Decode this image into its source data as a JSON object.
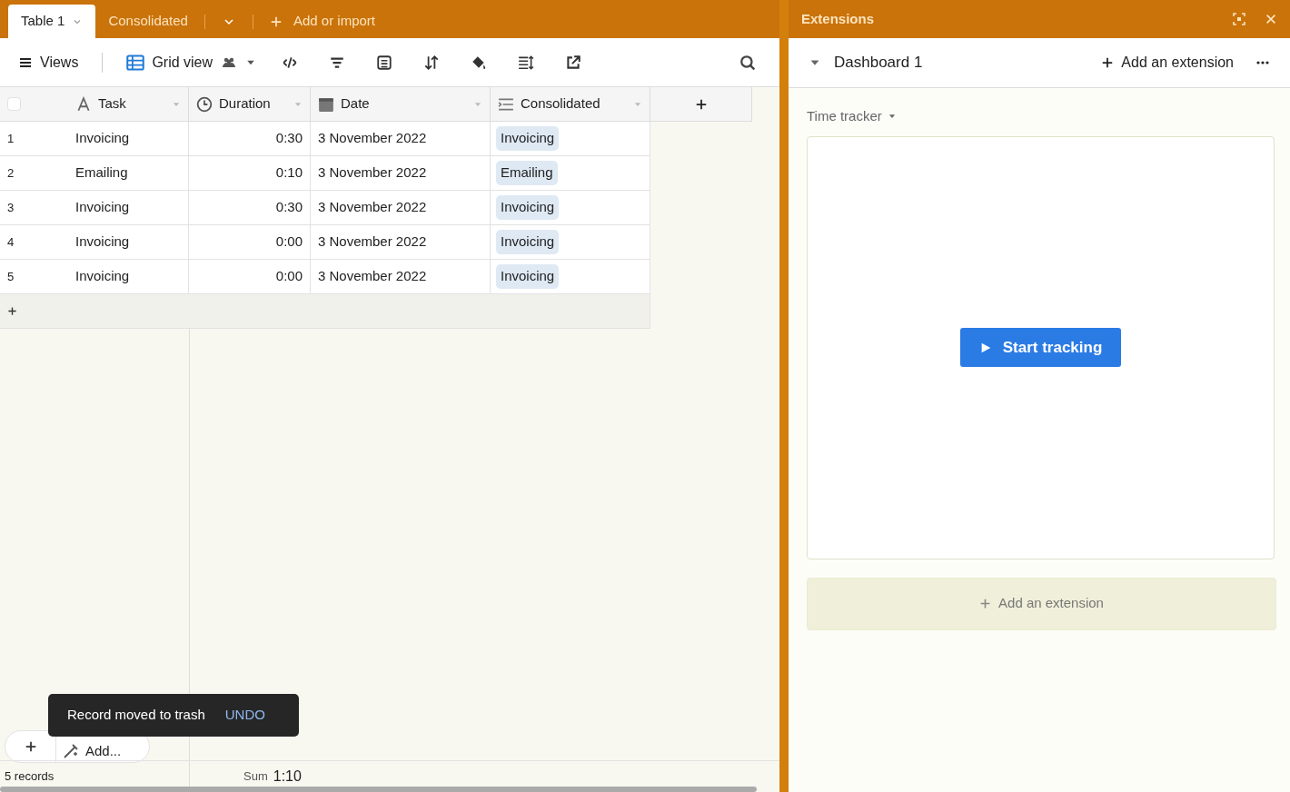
{
  "tabs": [
    {
      "label": "Table 1",
      "selected": true
    },
    {
      "label": "Consolidated",
      "selected": false
    }
  ],
  "add_import": "Add or import",
  "select_all": {
    "checked": false
  },
  "toolbar": {
    "views": "Views",
    "view_name": "Grid view"
  },
  "columns": [
    {
      "label": "Task",
      "kind": "text"
    },
    {
      "label": "Duration",
      "kind": "duration"
    },
    {
      "label": "Date",
      "kind": "date"
    },
    {
      "label": "Consolidated",
      "kind": "lookup"
    }
  ],
  "rows": [
    {
      "number": "1",
      "task": "Invoicing",
      "duration": "0:30",
      "date": "3 November 2022",
      "consolidated": "Invoicing"
    },
    {
      "number": "2",
      "task": "Emailing",
      "duration": "0:10",
      "date": "3 November 2022",
      "consolidated": "Emailing"
    },
    {
      "number": "3",
      "task": "Invoicing",
      "duration": "0:30",
      "date": "3 November 2022",
      "consolidated": "Invoicing"
    },
    {
      "number": "4",
      "task": "Invoicing",
      "duration": "0:00",
      "date": "3 November 2022",
      "consolidated": "Invoicing"
    },
    {
      "number": "5",
      "task": "Invoicing",
      "duration": "0:00",
      "date": "3 November 2022",
      "consolidated": "Invoicing"
    }
  ],
  "footer": {
    "add_label": "Add...",
    "records": "5 records",
    "sum_label": "Sum",
    "sum_value": "1:10"
  },
  "toast": {
    "message": "Record moved to trash",
    "action": "UNDO"
  },
  "extensions": {
    "title": "Extensions",
    "dashboard": "Dashboard 1",
    "add_extension": "Add an extension",
    "widget_title": "Time tracker",
    "start_button": "Start tracking",
    "add_panel": "Add an extension"
  }
}
